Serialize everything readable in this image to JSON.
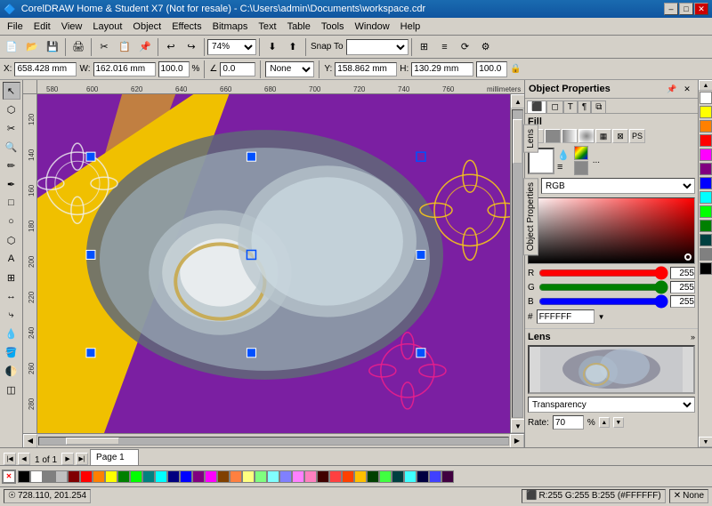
{
  "titlebar": {
    "title": "CorelDRAW Home & Student X7 (Not for resale) - C:\\Users\\admin\\Documents\\workspace.cdr",
    "minimize": "–",
    "maximize": "□",
    "close": "✕"
  },
  "menu": {
    "items": [
      "File",
      "Edit",
      "View",
      "Layout",
      "Object",
      "Effects",
      "Bitmaps",
      "Text",
      "Table",
      "Tools",
      "Window",
      "Help"
    ]
  },
  "toolbar1": {
    "zoom_level": "74%",
    "snap_to": "Snap To"
  },
  "toolbar3": {
    "x_label": "X:",
    "x_value": "658.428 mm",
    "y_label": "Y:",
    "y_value": "158.862 mm",
    "w_label": "W:",
    "w_value": "162.016 mm",
    "h_label": "H:",
    "h_value": "130.29 mm",
    "w_pct": "100.0",
    "h_pct": "100.0",
    "angle": "0.0",
    "none_dropdown": "None"
  },
  "object_properties": {
    "title": "Object Properties"
  },
  "prop_tabs": [
    {
      "label": "⬛",
      "title": "fill"
    },
    {
      "label": "◻",
      "title": "stroke"
    },
    {
      "label": "T",
      "title": "text"
    },
    {
      "label": "≡",
      "title": "paragraph"
    },
    {
      "label": "⧉",
      "title": "frame"
    }
  ],
  "fill_section": {
    "title": "Fill",
    "buttons": [
      "✕",
      "□",
      "▦",
      "▤",
      "⊠",
      "▣"
    ],
    "color_buttons": [
      "⊕",
      "≡",
      "□",
      "⬛",
      "..."
    ],
    "color_model": "RGB",
    "hex_value": "#FFFFFF",
    "r_value": "255",
    "g_value": "255",
    "b_value": "255",
    "checkbox_checked": false
  },
  "lens_section": {
    "title": "Lens",
    "expand_icon": "»",
    "dropdown_value": "Transparency",
    "rate_label": "Rate:",
    "rate_value": "70",
    "rate_unit": "%"
  },
  "page_nav": {
    "current": "1",
    "total": "1",
    "page_label": "Page 1"
  },
  "statusbar": {
    "coordinates": "728.110, 201.254",
    "color_info": "R:255 G:255 B:255 (#FFFFFF)",
    "fill_status": "None",
    "lock_icon": "🔒"
  },
  "palette_colors": [
    "#000000",
    "#ffffff",
    "#808080",
    "#c0c0c0",
    "#800000",
    "#ff0000",
    "#ff8000",
    "#ffff00",
    "#008000",
    "#00ff00",
    "#008080",
    "#00ffff",
    "#000080",
    "#0000ff",
    "#800080",
    "#ff00ff",
    "#804000",
    "#ff8040",
    "#ffff80",
    "#80ff80",
    "#80ffff",
    "#8080ff",
    "#ff80ff",
    "#ff80c0",
    "#400000",
    "#ff4040",
    "#ff4000",
    "#ffc000",
    "#004000",
    "#40ff40",
    "#004040",
    "#40ffff",
    "#000040",
    "#4040ff",
    "#400040",
    "#ff40ff",
    "#602020",
    "#e06060",
    "#c04000",
    "#c0a000"
  ],
  "canvas": {
    "ruler_label": "millimeters"
  }
}
